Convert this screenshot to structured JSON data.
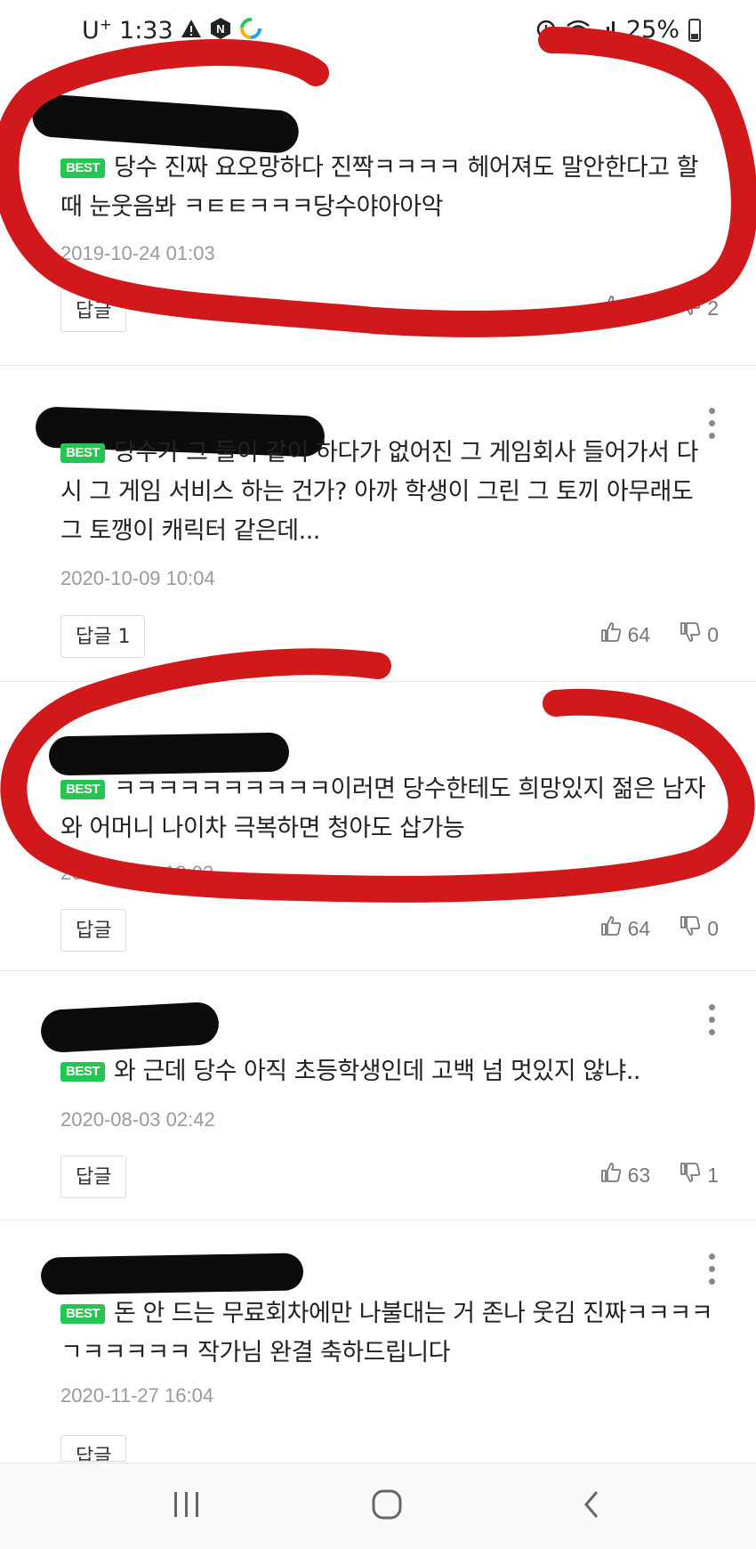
{
  "status_bar": {
    "carrier": "U",
    "carrier_sup": "+",
    "time": "1:33",
    "battery": "25%"
  },
  "comments": [
    {
      "badge": "BEST",
      "text": "당수 진짜 요오망하다 진짝ㅋㅋㅋㅋ 헤어져도 말안한다고 할때 눈웃음봐 ㅋㅌㅌㅋㅋㅋ당수야아아악",
      "date": "2019-10-24 01:03",
      "reply_label": "답글",
      "likes": "65",
      "dislikes": "2"
    },
    {
      "badge": "BEST",
      "text": "당수가 그 둘이 같이 하다가 없어진 그 게임회사 들어가서 다시 그 게임 서비스 하는 건가? 아까 학생이 그린 그 토끼 아무래도 그 토깽이 캐릭터 같은데...",
      "date": "2020-10-09 10:04",
      "reply_label": "답글 1",
      "likes": "64",
      "dislikes": "0"
    },
    {
      "badge": "BEST",
      "text": "ㅋㅋㅋㅋㅋㅋㅋㅋㅋㅋ이러면 당수한테도 희망있지 젊은 남자와 어머니 나이차 극복하면 청아도 삽가능",
      "date": "2020-06-11 13:02",
      "reply_label": "답글",
      "likes": "64",
      "dislikes": "0"
    },
    {
      "badge": "BEST",
      "text": "와 근데 당수 아직 초등학생인데 고백 넘 멋있지 않냐..",
      "date": "2020-08-03 02:42",
      "reply_label": "답글",
      "likes": "63",
      "dislikes": "1"
    },
    {
      "badge": "BEST",
      "text": "돈 안 드는 무료회차에만 나불대는 거 존나 웃김 진짜ㅋㅋㅋㅋㄱㅋㅋㅋㅋㅋ 작가님 완결 축하드립니다",
      "date": "2020-11-27 16:04",
      "reply_label": "답글",
      "likes": "",
      "dislikes": ""
    }
  ],
  "colors": {
    "best_badge": "#27c452",
    "marker_red": "#d1191c",
    "date_text": "#9a9a9a"
  },
  "icons": {
    "like": "thumbs-up-icon",
    "dislike": "thumbs-down-icon",
    "more": "more-vertical-icon",
    "nav_recents": "recent-apps-icon",
    "nav_home": "home-icon",
    "nav_back": "back-icon"
  }
}
